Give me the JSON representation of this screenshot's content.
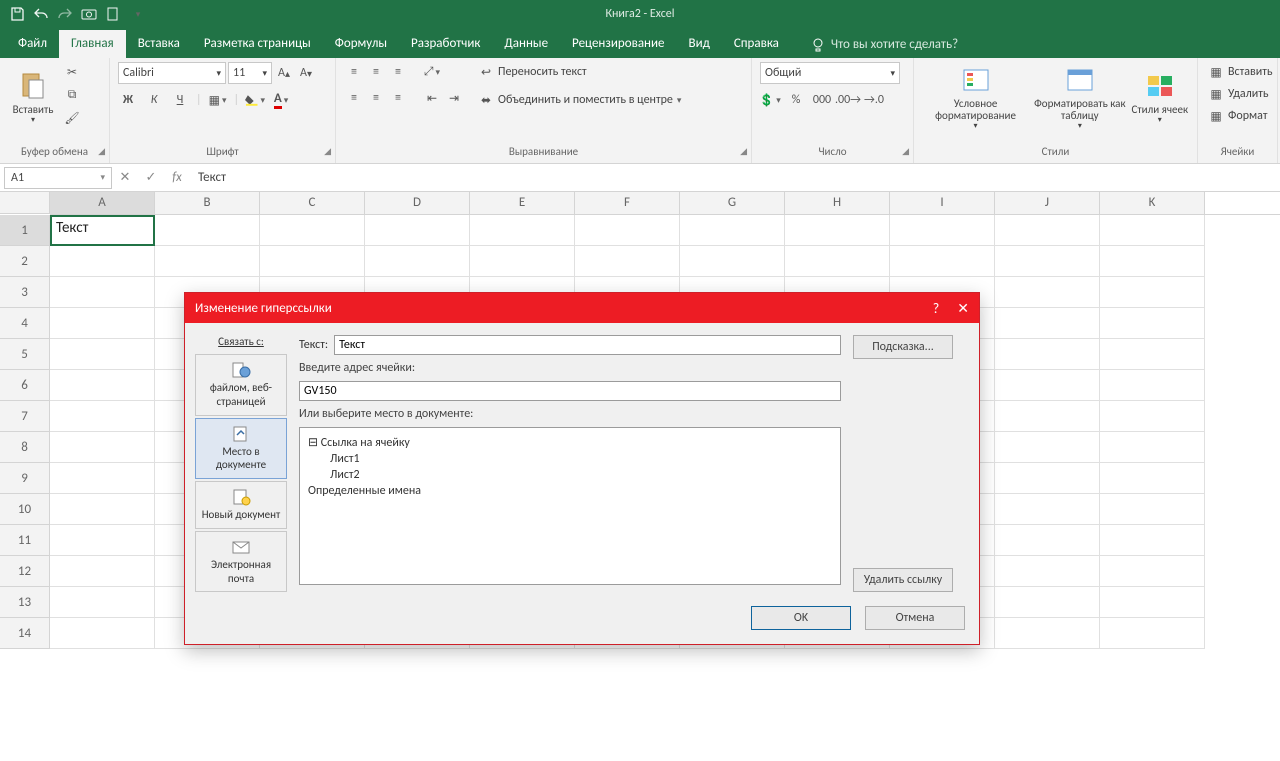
{
  "app": {
    "title": "Книга2 - Excel"
  },
  "tabs": {
    "file": "Файл",
    "home": "Главная",
    "insert": "Вставка",
    "layout": "Разметка страницы",
    "formulas": "Формулы",
    "developer": "Разработчик",
    "data": "Данные",
    "review": "Рецензирование",
    "view": "Вид",
    "help": "Справка",
    "tellme": "Что вы хотите сделать?"
  },
  "ribbon": {
    "clipboard": {
      "label": "Буфер обмена",
      "paste": "Вставить"
    },
    "font": {
      "label": "Шрифт",
      "family": "Calibri",
      "size": "11",
      "bold": "Ж",
      "italic": "К",
      "underline": "Ч"
    },
    "alignment": {
      "label": "Выравнивание",
      "wrap": "Переносить текст",
      "merge": "Объединить и поместить в центре"
    },
    "number": {
      "label": "Число",
      "format": "Общий"
    },
    "styles": {
      "label": "Стили",
      "conditional": "Условное форматирование",
      "formatTable": "Форматировать как таблицу",
      "cellStyles": "Стили ячеек"
    },
    "cells": {
      "label": "Ячейки",
      "insert": "Вставить",
      "delete": "Удалить",
      "format": "Формат"
    }
  },
  "formula_bar": {
    "name_box": "A1",
    "value": "Текст"
  },
  "grid": {
    "columns": [
      "A",
      "B",
      "C",
      "D",
      "E",
      "F",
      "G",
      "H",
      "I",
      "J",
      "K"
    ],
    "rows": [
      "1",
      "2",
      "3",
      "4",
      "5",
      "6",
      "7",
      "8",
      "9",
      "10",
      "11",
      "12",
      "13",
      "14"
    ],
    "a1_value": "Текст"
  },
  "dialog": {
    "title": "Изменение гиперссылки",
    "link_to_label": "Связать с:",
    "text_label": "Текст:",
    "text_value": "Текст",
    "screentip": "Подсказка...",
    "address_label": "Введите адрес ячейки:",
    "address_value": "GV150",
    "place_label": "Или выберите место в документе:",
    "tree": {
      "cellref": "Ссылка на ячейку",
      "sheet1": "Лист1",
      "sheet2": "Лист2",
      "defined": "Определенные имена"
    },
    "linkto": {
      "file": "файлом, веб-страницей",
      "place": "Место в документе",
      "newdoc": "Новый документ",
      "email": "Электронная почта"
    },
    "remove": "Удалить ссылку",
    "ok": "OK",
    "cancel": "Отмена"
  }
}
